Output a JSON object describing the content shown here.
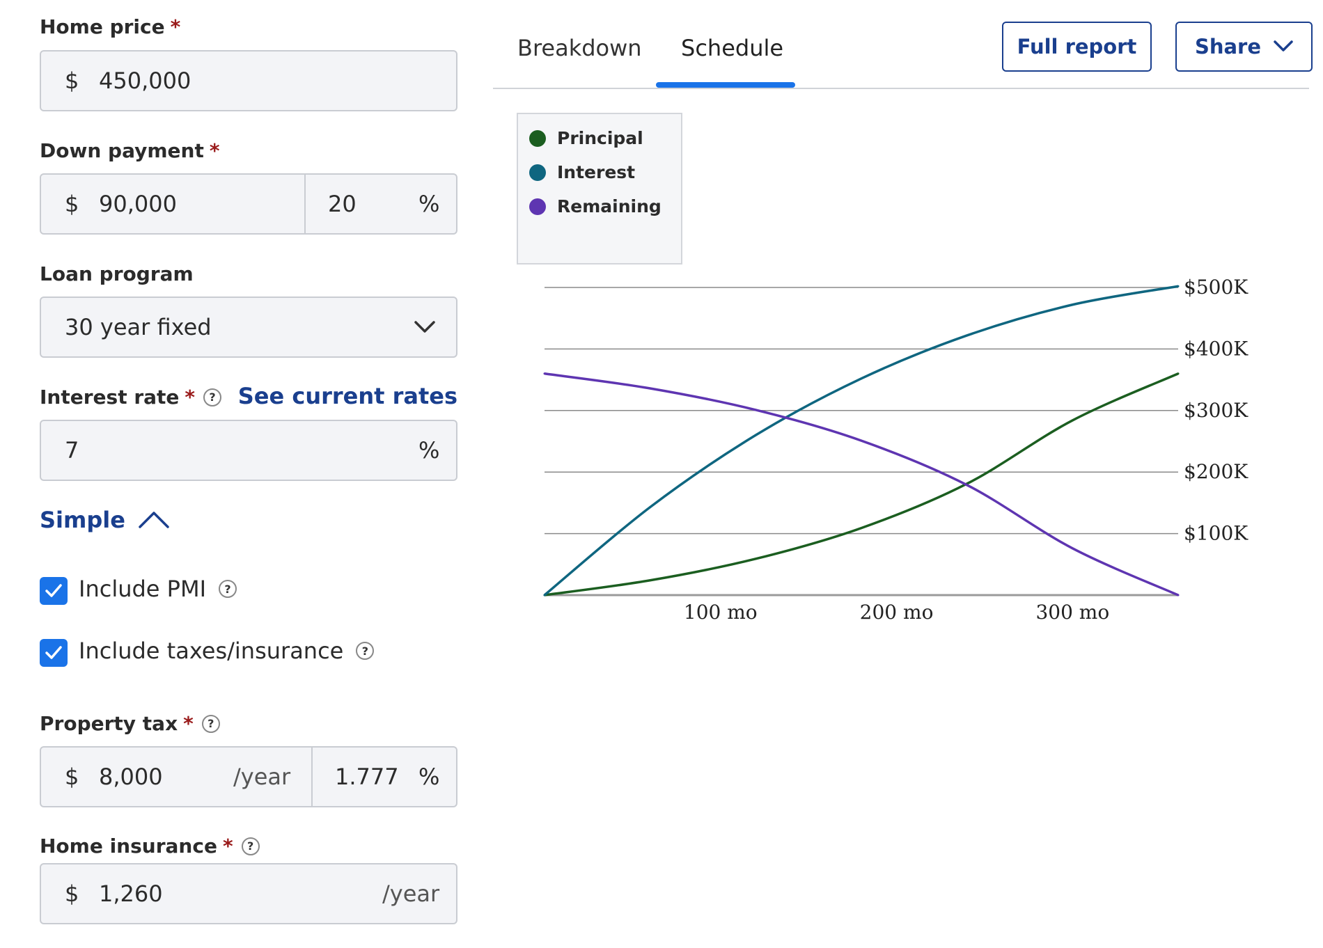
{
  "form": {
    "home_price": {
      "label": "Home price",
      "required": "*",
      "currency": "$",
      "value": "450,000"
    },
    "down_payment": {
      "label": "Down payment",
      "required": "*",
      "currency": "$",
      "amount": "90,000",
      "percent": "20",
      "percent_sign": "%"
    },
    "loan_program": {
      "label": "Loan program",
      "value": "30 year fixed"
    },
    "interest_rate": {
      "label": "Interest rate",
      "required": "*",
      "help": "?",
      "link": "See current rates",
      "value": "7",
      "percent_sign": "%"
    },
    "simple_toggle": {
      "label": "Simple"
    },
    "include_pmi": {
      "label": "Include PMI",
      "checked": true,
      "help": "?"
    },
    "include_taxes": {
      "label": "Include taxes/insurance",
      "checked": true,
      "help": "?"
    },
    "property_tax": {
      "label": "Property tax",
      "required": "*",
      "help": "?",
      "currency": "$",
      "amount": "8,000",
      "unit": "/year",
      "percent": "1.777",
      "percent_sign": "%"
    },
    "home_insurance": {
      "label": "Home insurance",
      "required": "*",
      "help": "?",
      "currency": "$",
      "amount": "1,260",
      "unit": "/year"
    }
  },
  "tabs": [
    {
      "label": "Breakdown",
      "active": false
    },
    {
      "label": "Schedule",
      "active": true
    }
  ],
  "buttons": {
    "full_report": "Full report",
    "share": "Share"
  },
  "colors": {
    "principal": "#1b5e20",
    "interest": "#0f6680",
    "remaining": "#5e35b1",
    "accent": "#1a73e8",
    "link": "#1a3f8e"
  },
  "chart_data": {
    "type": "line",
    "legend": [
      "Principal",
      "Interest",
      "Remaining"
    ],
    "legend_placement": "top-left",
    "x_ticks": [
      {
        "value": 100,
        "label": "100 mo"
      },
      {
        "value": 200,
        "label": "200 mo"
      },
      {
        "value": 300,
        "label": "300 mo"
      }
    ],
    "y_ticks": [
      {
        "value": 100000,
        "label": "$100K"
      },
      {
        "value": 200000,
        "label": "$200K"
      },
      {
        "value": 300000,
        "label": "$300K"
      },
      {
        "value": 400000,
        "label": "$400K"
      },
      {
        "value": 500000,
        "label": "$500K"
      }
    ],
    "xlim": [
      0,
      360
    ],
    "ylim": [
      0,
      500000
    ],
    "y_axis_side": "right",
    "grid": true,
    "series": [
      {
        "name": "Principal",
        "color": "#1b5e20",
        "x": [
          0,
          60,
          120,
          180,
          240,
          300,
          360
        ],
        "y": [
          0,
          24000,
          59000,
          109000,
          181000,
          284000,
          360000
        ]
      },
      {
        "name": "Interest",
        "color": "#0f6680",
        "x": [
          0,
          60,
          120,
          180,
          240,
          300,
          360
        ],
        "y": [
          0,
          143000,
          260000,
          352000,
          422000,
          472000,
          502000
        ]
      },
      {
        "name": "Remaining",
        "color": "#5e35b1",
        "x": [
          0,
          60,
          120,
          180,
          240,
          300,
          360
        ],
        "y": [
          360000,
          336000,
          301000,
          251000,
          179000,
          76000,
          0
        ]
      }
    ]
  }
}
